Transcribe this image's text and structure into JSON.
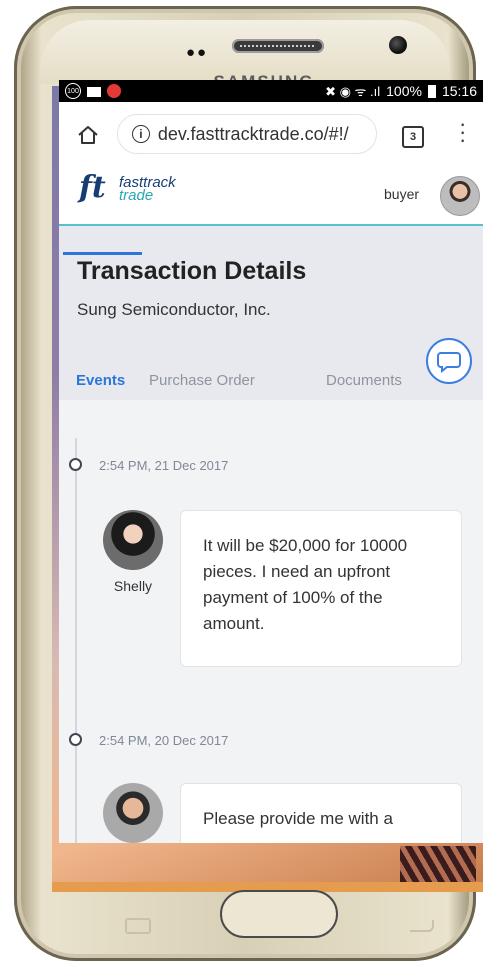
{
  "phone": {
    "brand": "SAMSUNG"
  },
  "status_bar": {
    "battery_circle": "100",
    "signal_battery": "100%",
    "time": "15:16"
  },
  "browser": {
    "url": "dev.fasttracktrade.co/#!/",
    "tab_count": "3",
    "info_glyph": "i"
  },
  "app_header": {
    "logo_mark": "ft",
    "logo_name": "fasttrack",
    "logo_sub": "trade",
    "user_role": "buyer"
  },
  "page": {
    "title": "Transaction Details",
    "company": "Sung Semiconductor, Inc."
  },
  "tabs": [
    {
      "label": "Events",
      "active": true
    },
    {
      "label": "Purchase Order",
      "active": false
    },
    {
      "label": "Documents",
      "active": false
    }
  ],
  "events": [
    {
      "time": "2:54 PM, 21 Dec 2017",
      "sender": "Shelly",
      "message": "It will be $20,000 for 10000 pieces. I need an upfront payment of 100% of the amount."
    },
    {
      "time": "2:54 PM, 20 Dec 2017",
      "sender": "",
      "message": "Please provide me with a"
    }
  ],
  "colors": {
    "accent_blue": "#2d76d9",
    "logo_navy": "#163e73",
    "logo_teal": "#26b5c6",
    "header_border": "#5ac1c9"
  },
  "icons": [
    "home-icon",
    "info-icon",
    "tab-switcher-icon",
    "more-vert-icon",
    "chat-icon"
  ]
}
